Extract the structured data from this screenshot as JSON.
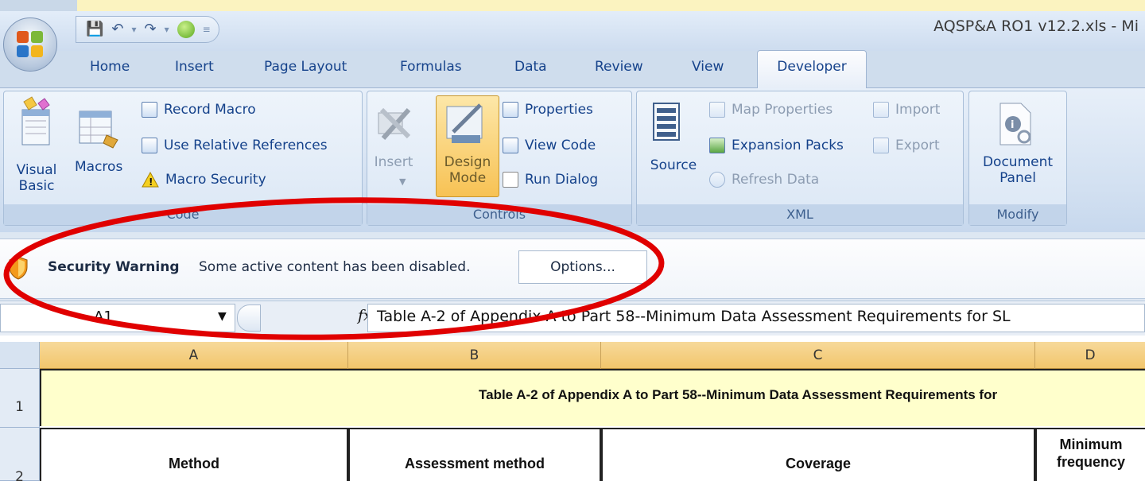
{
  "quick_access": {
    "save_icon": "save-icon",
    "undo_icon": "undo-icon",
    "redo_icon": "redo-icon",
    "customize_icon": "qat-dropdown-icon"
  },
  "window": {
    "title": "AQSP&A RO1 v12.2.xls - Mi"
  },
  "tabs": [
    "Home",
    "Insert",
    "Page Layout",
    "Formulas",
    "Data",
    "Review",
    "View",
    "Developer"
  ],
  "ribbon": {
    "code": {
      "label": "Code",
      "visual_basic": "Visual Basic",
      "macros": "Macros",
      "record_macro": "Record Macro",
      "use_relative_refs": "Use Relative References",
      "macro_security": "Macro Security"
    },
    "controls": {
      "label": "Controls",
      "insert": "Insert",
      "design_mode": "Design Mode",
      "properties": "Properties",
      "view_code": "View Code",
      "run_dialog": "Run Dialog"
    },
    "xml": {
      "label": "XML",
      "source": "Source",
      "map_properties": "Map Properties",
      "expansion_packs": "Expansion Packs",
      "refresh_data": "Refresh Data",
      "import": "Import",
      "export": "Export"
    },
    "modify": {
      "label": "Modify",
      "document_panel": "Document Panel"
    }
  },
  "message_bar": {
    "title": "Security Warning",
    "message": "Some active content has been disabled.",
    "options_button": "Options..."
  },
  "formula_bar": {
    "name_box": "A1",
    "fx": "fx",
    "formula": "Table A-2 of Appendix A to Part 58--Minimum Data Assessment Requirements for SL"
  },
  "sheet": {
    "columns": [
      "A",
      "B",
      "C",
      "D"
    ],
    "rows": [
      "1",
      "2"
    ],
    "row1": "Table A-2 of Appendix A to Part 58--Minimum Data Assessment Requirements for",
    "row2": {
      "a": "Method",
      "b": "Assessment method",
      "c": "Coverage",
      "d": "Minimum frequency"
    }
  },
  "annotation": {
    "color": "#e00000"
  }
}
